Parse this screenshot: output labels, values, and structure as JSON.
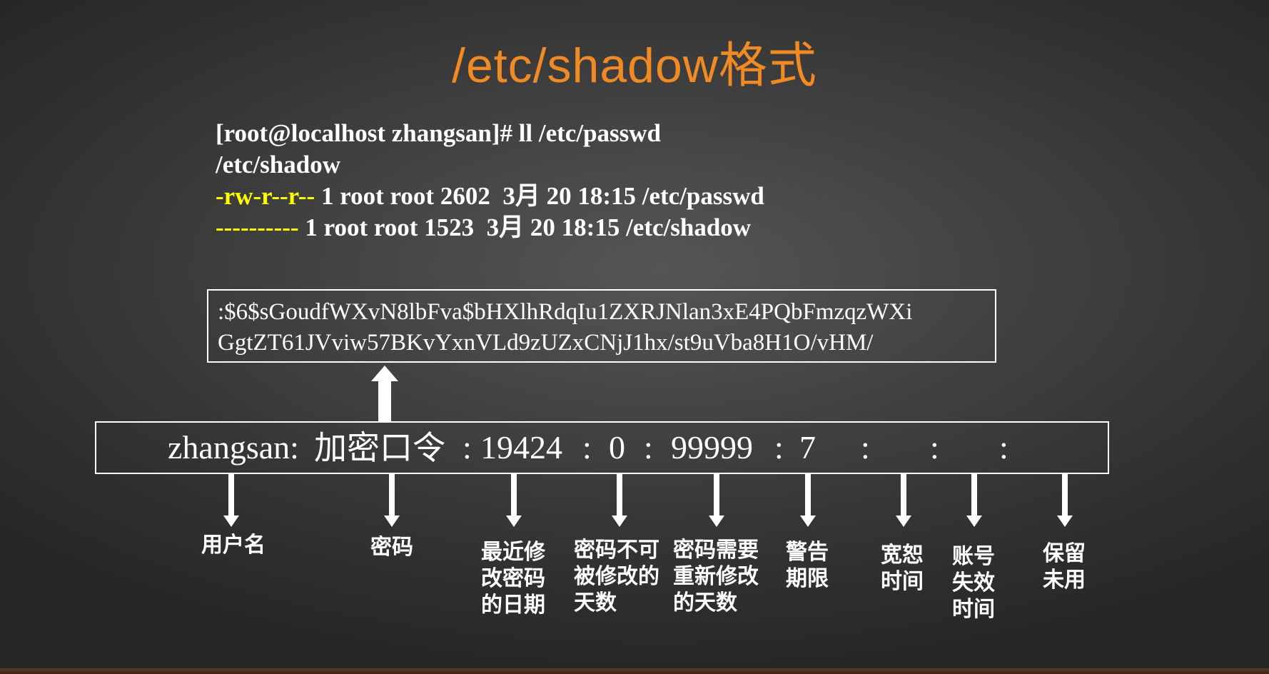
{
  "title": "/etc/shadow格式",
  "command": {
    "line1": "[root@localhost zhangsan]# ll /etc/passwd",
    "line2": "/etc/shadow",
    "line3_perm": "-rw-r--r--",
    "line3_rest": " 1 root root 2602  3月 20 18:15 /etc/passwd",
    "line4_perm": "----------",
    "line4_rest": " 1 root root 1523  3月 20 18:15 /etc/shadow"
  },
  "hash": {
    "line1": ":$6$sGoudfWXvN8lbFva$bHXlhRdqIu1ZXRJNlan3xE4PQbFmzqzWXi",
    "line2": "GgtZT61JVviw57BKvYxnVLd9zUZxCNjJ1hx/st9uVba8H1O/vHM/"
  },
  "fields": {
    "username": "zhangsan:",
    "password": "加密口令",
    "sep1": ":",
    "date": "19424",
    "sep2": ":",
    "min_days": "0",
    "sep3": ":",
    "max_days": "99999",
    "sep4": ":",
    "warn": "7",
    "sep5": ":",
    "sep6": ":",
    "sep7": ":"
  },
  "labels": {
    "username": [
      "用户名"
    ],
    "password": [
      "密码"
    ],
    "last_change": [
      "最近修",
      "改密码",
      "的日期"
    ],
    "min_days": [
      "密码不可",
      "被修改的",
      "天数"
    ],
    "max_days": [
      "密码需要",
      "重新修改",
      "的天数"
    ],
    "warn": [
      "警告",
      "期限"
    ],
    "inactive": [
      "宽恕",
      "时间"
    ],
    "expire": [
      "账号",
      "失效",
      "时间"
    ],
    "reserved": [
      "保留",
      "未用"
    ]
  },
  "colors": {
    "title": "#f08a24",
    "permission": "#ffff00",
    "text": "#ffffff"
  }
}
